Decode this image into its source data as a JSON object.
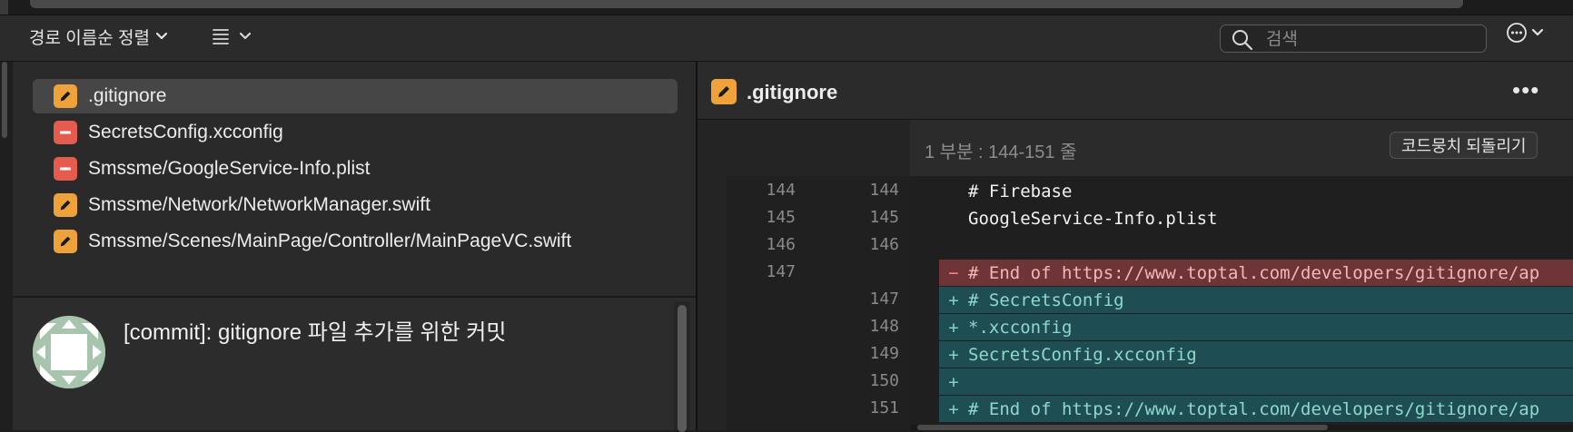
{
  "toolbar": {
    "sort_label": "경로 이름순 정렬",
    "search_placeholder": "검색"
  },
  "files": [
    {
      "name": ".gitignore",
      "status": "modified",
      "selected": true
    },
    {
      "name": "SecretsConfig.xcconfig",
      "status": "deleted",
      "selected": false
    },
    {
      "name": "Smssme/GoogleService-Info.plist",
      "status": "deleted",
      "selected": false
    },
    {
      "name": "Smssme/Network/NetworkManager.swift",
      "status": "modified",
      "selected": false
    },
    {
      "name": "Smssme/Scenes/MainPage/Controller/MainPageVC.swift",
      "status": "modified",
      "selected": false
    }
  ],
  "commit": {
    "message": "[commit]: gitignore 파일 추가를 위한 커밋"
  },
  "diff": {
    "file_title": ".gitignore",
    "hunk_label": "1 부분 : 144-151 줄",
    "revert_label": "코드뭉치 되돌리기",
    "lines": [
      {
        "old": "144",
        "new": "144",
        "type": "ctx",
        "sign": "",
        "text": "# Firebase"
      },
      {
        "old": "145",
        "new": "145",
        "type": "ctx",
        "sign": "",
        "text": "GoogleService-Info.plist"
      },
      {
        "old": "146",
        "new": "146",
        "type": "ctx",
        "sign": "",
        "text": ""
      },
      {
        "old": "147",
        "new": "",
        "type": "del",
        "sign": "−",
        "text": "# End of https://www.toptal.com/developers/gitignore/ap"
      },
      {
        "old": "",
        "new": "147",
        "type": "add",
        "sign": "+",
        "text": "# SecretsConfig"
      },
      {
        "old": "",
        "new": "148",
        "type": "add",
        "sign": "+",
        "text": "*.xcconfig"
      },
      {
        "old": "",
        "new": "149",
        "type": "add",
        "sign": "+",
        "text": "SecretsConfig.xcconfig"
      },
      {
        "old": "",
        "new": "150",
        "type": "add",
        "sign": "+",
        "text": ""
      },
      {
        "old": "",
        "new": "151",
        "type": "add",
        "sign": "+",
        "text": "# End of https://www.toptal.com/developers/gitignore/ap"
      }
    ]
  },
  "colors": {
    "modified": "#f0a23a",
    "deleted": "#e55b4d",
    "accent_add": "#1f4d54",
    "accent_del": "#6e3437"
  }
}
